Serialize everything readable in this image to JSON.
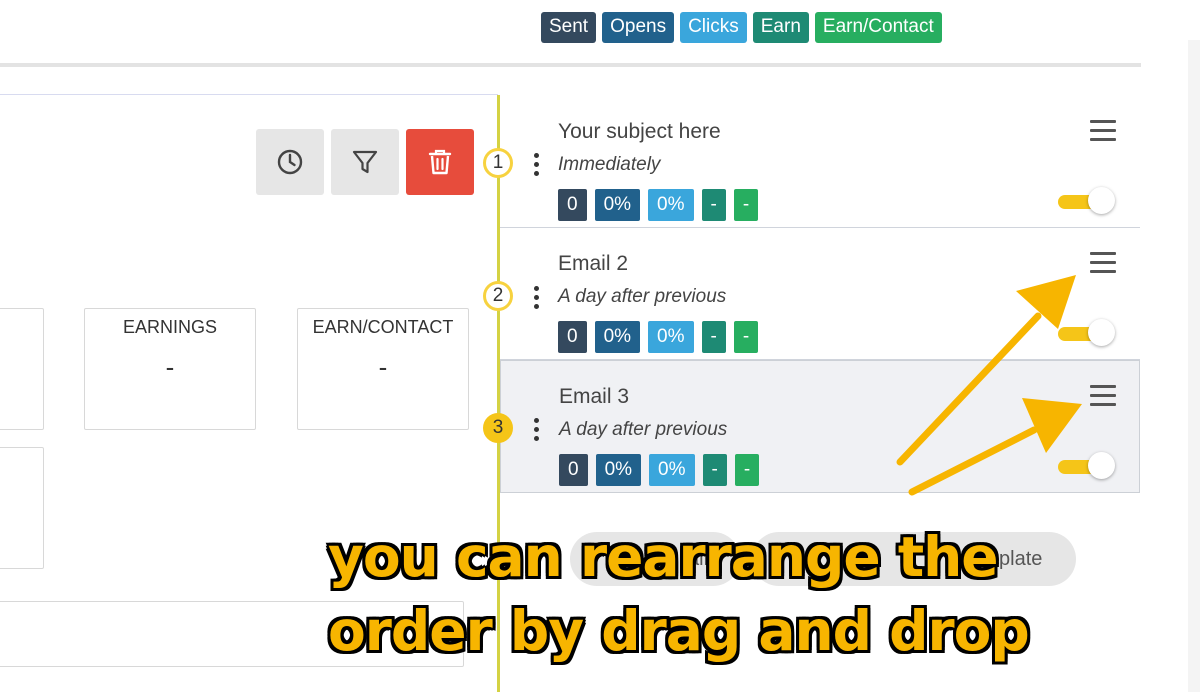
{
  "legend": {
    "sent": "Sent",
    "opens": "Opens",
    "clicks": "Clicks",
    "earn": "Earn",
    "earn_contact": "Earn/Contact"
  },
  "stat_boxes": {
    "earnings": {
      "label": "EARNINGS",
      "value": "-"
    },
    "earn_contact": {
      "label": "EARN/CONTACT",
      "value": "-"
    }
  },
  "emails": [
    {
      "step": "1",
      "subject": "Your subject here",
      "timing": "Immediately",
      "sent": "0",
      "opens": "0%",
      "clicks": "0%",
      "earn": "-",
      "earn_contact": "-",
      "enabled": true
    },
    {
      "step": "2",
      "subject": "Email 2",
      "timing": "A day after previous",
      "sent": "0",
      "opens": "0%",
      "clicks": "0%",
      "earn": "-",
      "earn_contact": "-",
      "enabled": true
    },
    {
      "step": "3",
      "subject": "Email 3",
      "timing": "A day after previous",
      "sent": "0",
      "opens": "0%",
      "clicks": "0%",
      "earn": "-",
      "earn_contact": "-",
      "enabled": true
    }
  ],
  "buttons_partial": {
    "add_email": "ail",
    "template": "plate"
  },
  "caption": {
    "line1": "you can rearrange the",
    "line2": "order by drag and drop"
  },
  "colors": {
    "sent": "#34495e",
    "opens": "#21618c",
    "clicks": "#3aa6dc",
    "earn": "#1e8a74",
    "earn_contact": "#27ae60",
    "accent_yellow": "#f5c518",
    "delete_red": "#e74c3c"
  }
}
